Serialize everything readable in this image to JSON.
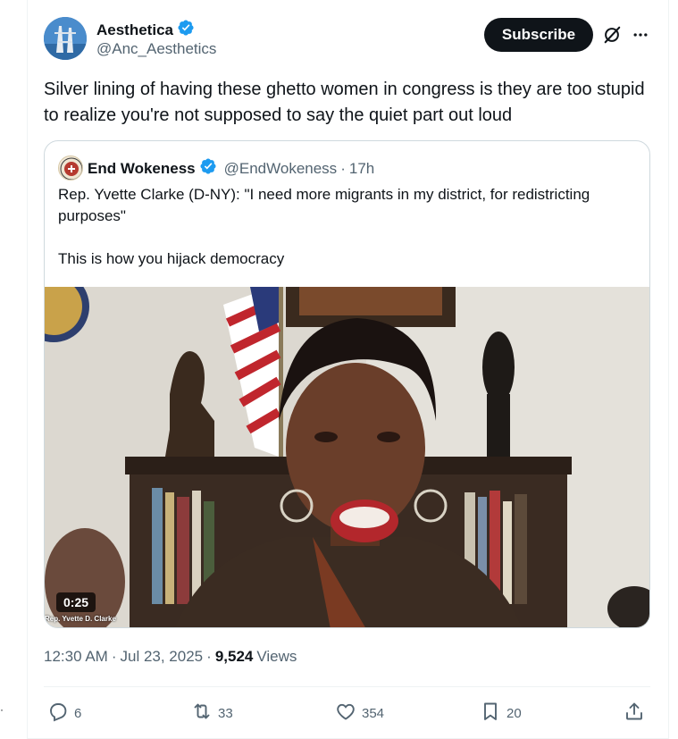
{
  "author": {
    "name": "Aesthetica",
    "handle": "@Anc_Aesthetics",
    "verified": true
  },
  "header": {
    "subscribe_label": "Subscribe"
  },
  "tweet": {
    "text": "Silver lining of having these ghetto women in congress is they are too stupid to realize you're not supposed to say the quiet part out loud"
  },
  "quoted_tweet": {
    "name": "End Wokeness",
    "handle": "@EndWokeness",
    "separator": "·",
    "time": "17h",
    "verified": true,
    "paragraphs": [
      "Rep. Yvette Clarke (D-NY): \"I need more migrants in my district, for redistricting purposes\"",
      "This is how you hijack democracy"
    ],
    "video": {
      "duration": "0:25",
      "caption": "Rep. Yvette D. Clarke"
    }
  },
  "meta": {
    "time": "12:30 AM",
    "separator": "·",
    "date": "Jul 23, 2025",
    "views_count": "9,524",
    "views_label": "Views"
  },
  "actions": {
    "replies": "6",
    "reposts": "33",
    "likes": "354",
    "bookmarks": "20"
  },
  "misc": {
    "stray_mark": "·"
  },
  "colors": {
    "verified_blue": "#1d9bf0",
    "text_primary": "#0f1419",
    "text_secondary": "#536471",
    "subscribe_bg": "#0f1419",
    "border": "#cfd9de"
  },
  "icons": {
    "verified": "verified-badge-icon",
    "grok": "grok-icon",
    "more": "more-horizontal-icon",
    "reply": "reply-icon",
    "repost": "repost-icon",
    "like": "heart-icon",
    "bookmark": "bookmark-icon",
    "share": "share-icon"
  }
}
